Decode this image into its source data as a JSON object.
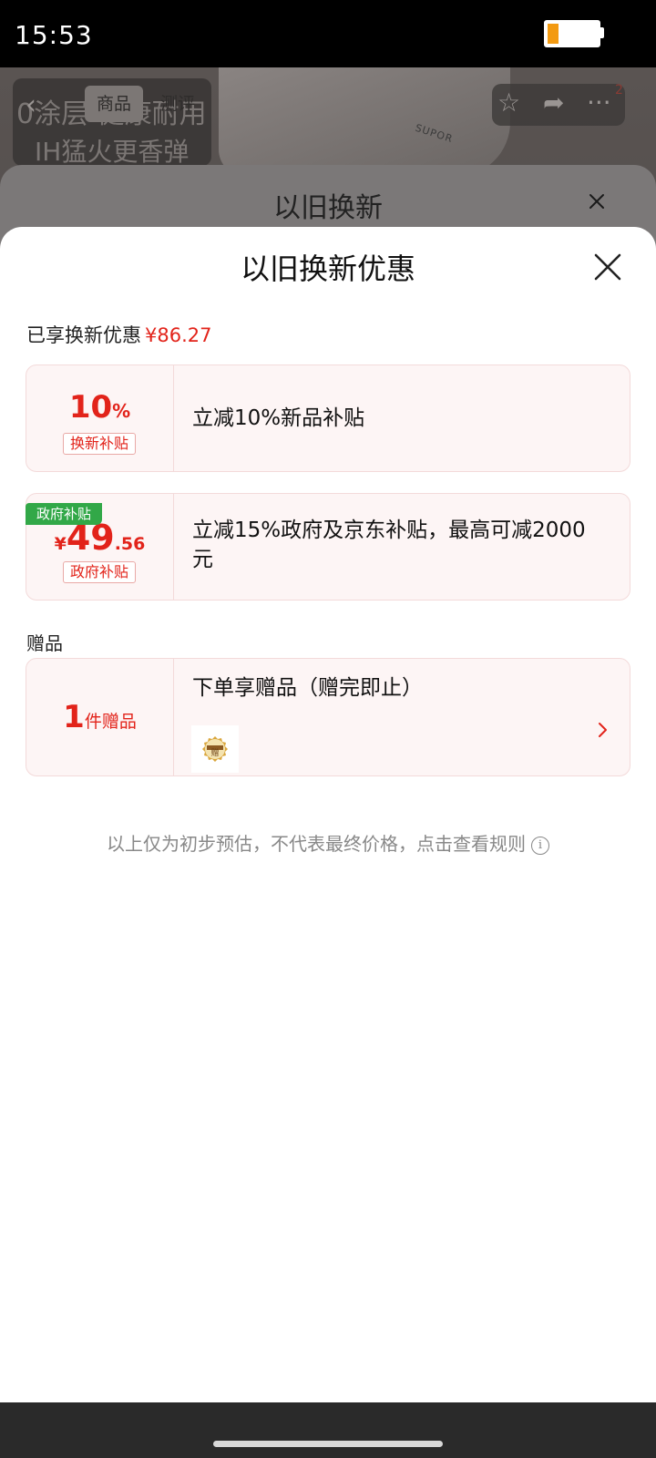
{
  "status_bar": {
    "time": "15:53"
  },
  "background": {
    "banner_line1": "0涂层 健康耐用",
    "banner_line2": "IH猛火更香弹",
    "product_brand": "SUPOR",
    "tab_product": "商品",
    "tab_review": "测评",
    "cart_badge": "2"
  },
  "sheet_behind": {
    "title": "以旧换新"
  },
  "sheet": {
    "title": "以旧换新优惠",
    "summary_label": "已享换新优惠",
    "summary_amount": "¥86.27",
    "cards": [
      {
        "big_num": "10",
        "big_unit": "%",
        "tag": "换新补贴",
        "text": "立减10%新品补贴"
      },
      {
        "ribbon": "政府补贴",
        "currency": "¥",
        "big_num": "49",
        "decimals": ".56",
        "tag": "政府补贴",
        "text_line1": "立减15%政府及京东补贴，最高可减2000",
        "text_line2": "元"
      }
    ],
    "gift_section_label": "赠品",
    "gift_card": {
      "count": "1",
      "count_unit": "件赠品",
      "text": "下单享赠品（赠完即止）",
      "thumb_text": "赠"
    },
    "notice": "以上仅为初步预估，不代表最终价格，点击查看规则",
    "notice_icon": "i"
  },
  "colors": {
    "accent_red": "#e2231a",
    "gov_green": "#32a848",
    "card_bg": "#fdf5f5"
  },
  "icons": [
    "back-icon",
    "star-icon",
    "share-icon",
    "more-icon",
    "close-icon",
    "chevron-right-icon",
    "info-icon",
    "battery-icon"
  ]
}
